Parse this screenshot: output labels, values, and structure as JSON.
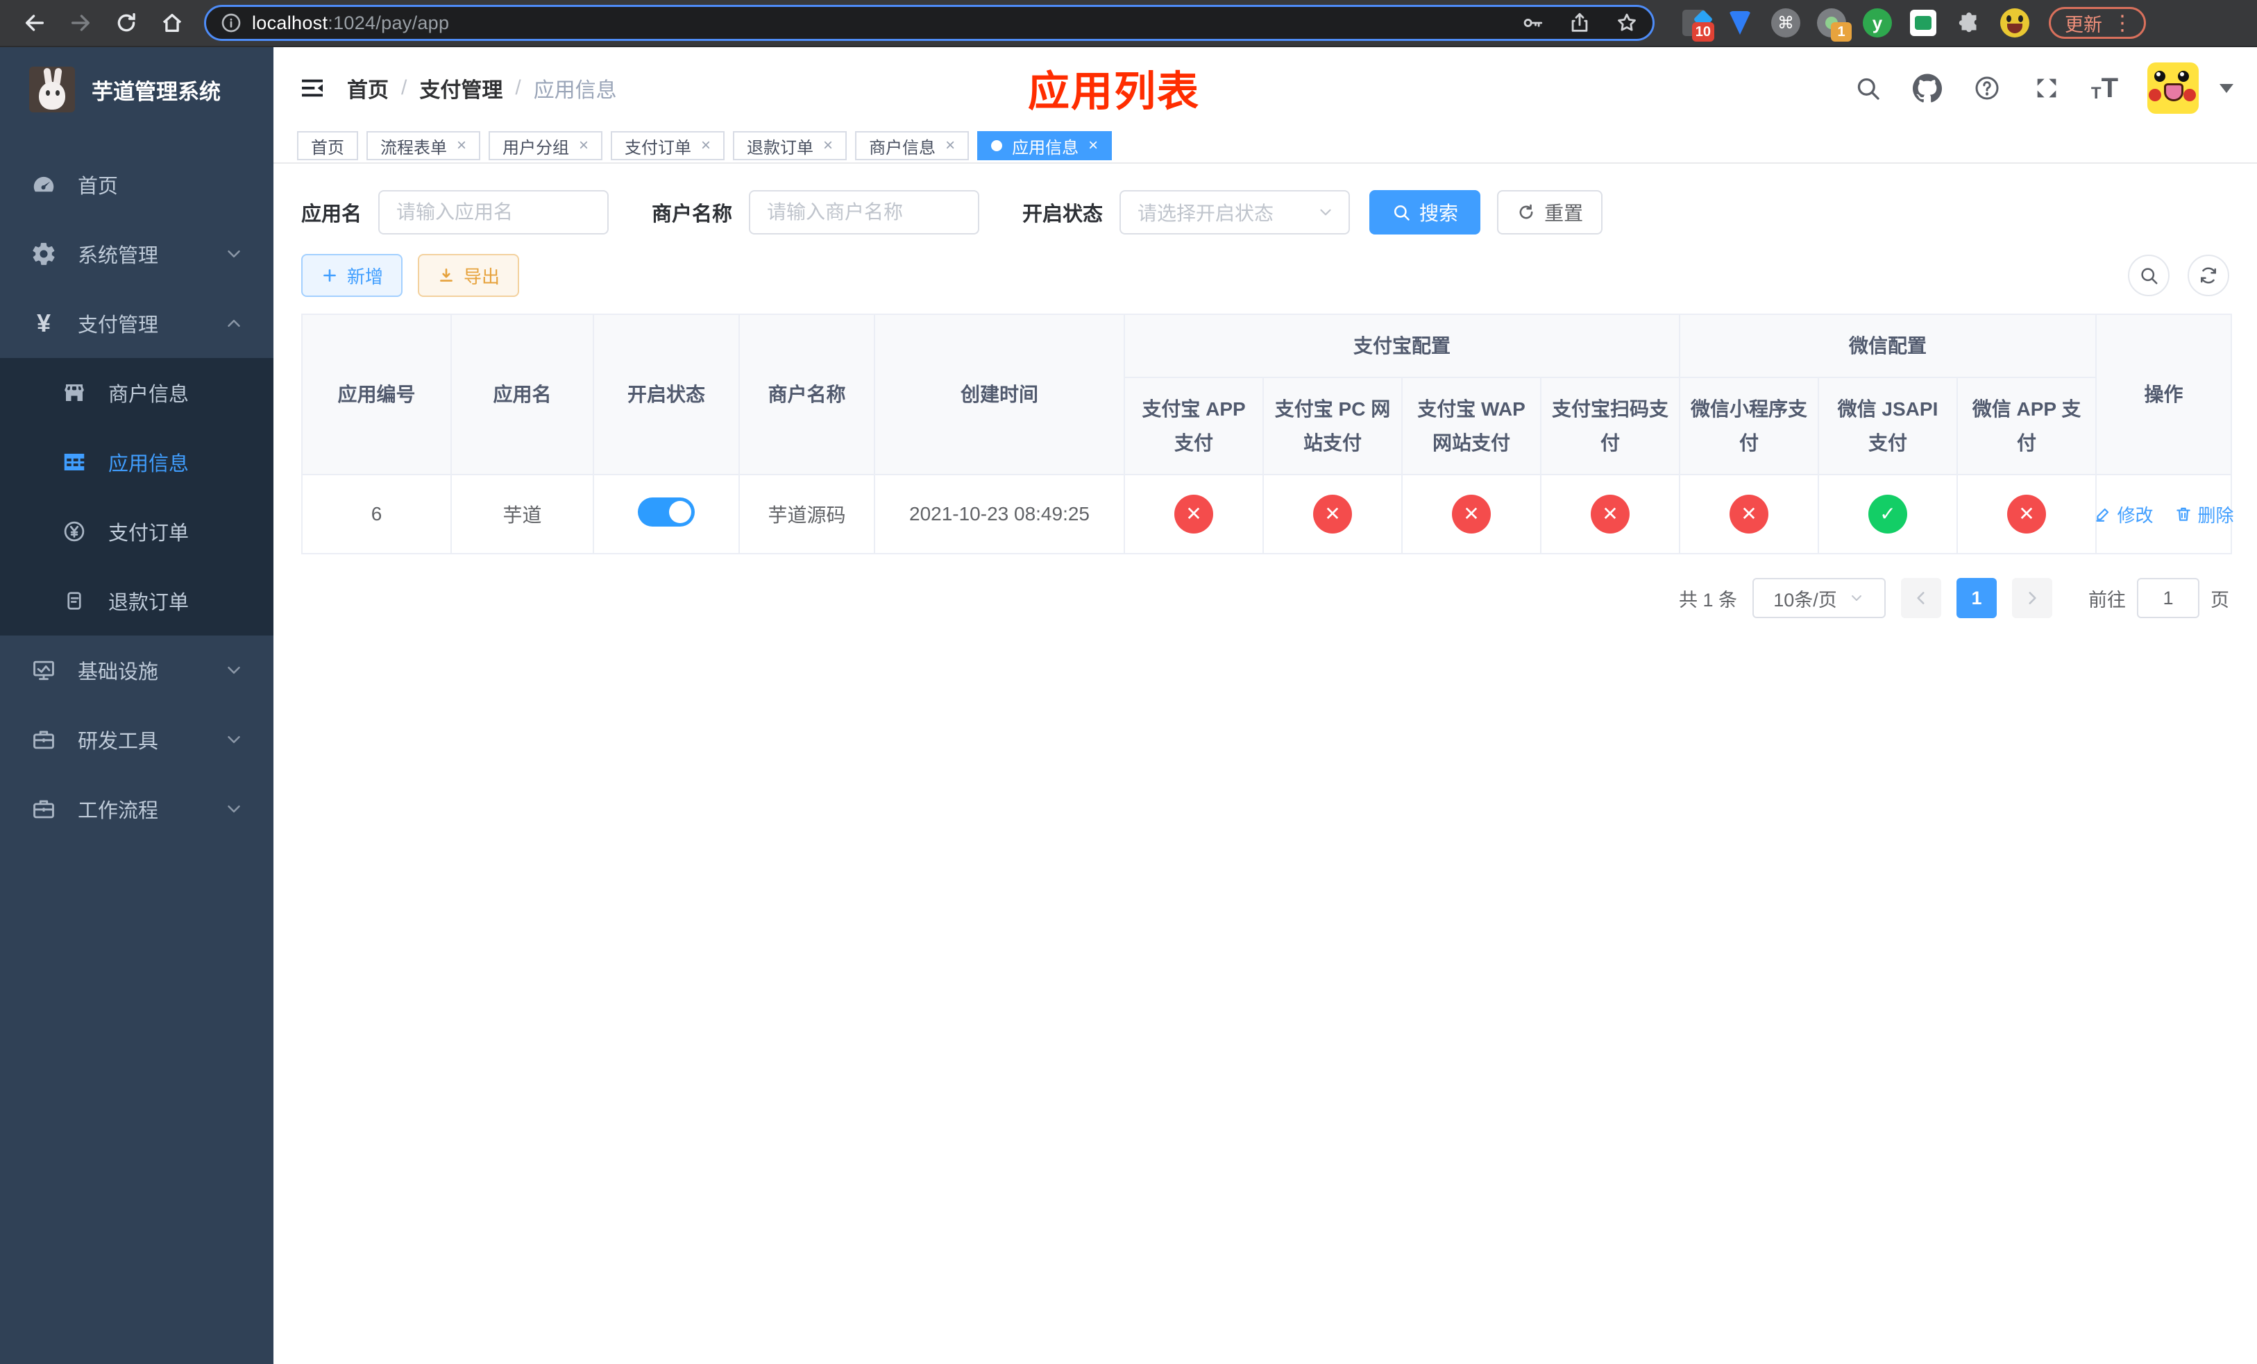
{
  "browser": {
    "url_host": "localhost",
    "url_path": ":1024/pay/app",
    "update_label": "更新",
    "ext_badges": {
      "pinned": "10",
      "recorder": "1"
    },
    "ext_y_label": "y"
  },
  "sidebar": {
    "title": "芋道管理系统",
    "items": [
      {
        "label": "首页"
      },
      {
        "label": "系统管理"
      },
      {
        "label": "支付管理"
      },
      {
        "label": "基础设施"
      },
      {
        "label": "研发工具"
      },
      {
        "label": "工作流程"
      }
    ],
    "pay_children": [
      {
        "label": "商户信息"
      },
      {
        "label": "应用信息"
      },
      {
        "label": "支付订单"
      },
      {
        "label": "退款订单"
      }
    ]
  },
  "header": {
    "breadcrumb": [
      "首页",
      "支付管理",
      "应用信息"
    ],
    "overlay_title": "应用列表",
    "overlay_color": "#ff2d00"
  },
  "tabs": {
    "close_glyph": "×",
    "items": [
      {
        "label": "首页"
      },
      {
        "label": "流程表单"
      },
      {
        "label": "用户分组"
      },
      {
        "label": "支付订单"
      },
      {
        "label": "退款订单"
      },
      {
        "label": "商户信息"
      },
      {
        "label": "应用信息"
      }
    ]
  },
  "filters": {
    "app_name_label": "应用名",
    "app_name_placeholder": "请输入应用名",
    "merchant_label": "商户名称",
    "merchant_placeholder": "请输入商户名称",
    "status_label": "开启状态",
    "status_placeholder": "请选择开启状态",
    "search_label": "搜索",
    "reset_label": "重置"
  },
  "toolbar": {
    "add_label": "新增",
    "export_label": "导出"
  },
  "table": {
    "groups": {
      "alipay": "支付宝配置",
      "wechat": "微信配置"
    },
    "columns": {
      "id": "应用编号",
      "name": "应用名",
      "status": "开启状态",
      "merchant": "商户名称",
      "created": "创建时间",
      "actions": "操作"
    },
    "channel_columns": [
      "支付宝 APP 支付",
      "支付宝 PC 网站支付",
      "支付宝 WAP 网站支付",
      "支付宝扫码支付",
      "微信小程序支付",
      "微信 JSAPI 支付",
      "微信 APP 支付"
    ],
    "glyphs": {
      "enabled": "✓",
      "disabled": "✕"
    },
    "row": {
      "id": "6",
      "name": "芋道",
      "enabled": true,
      "merchant": "芋道源码",
      "created": "2021-10-23 08:49:25",
      "channels": [
        false,
        false,
        false,
        false,
        false,
        true,
        false
      ],
      "edit_label": "修改",
      "delete_label": "删除"
    }
  },
  "pagination": {
    "total": "共 1 条",
    "page_size": "10条/页",
    "current_page": "1",
    "goto_label": "前往",
    "goto_value": "1",
    "page_unit": "页"
  },
  "colors": {
    "accent": "#409eff",
    "danger": "#f44c4c",
    "success": "#13ce66"
  }
}
